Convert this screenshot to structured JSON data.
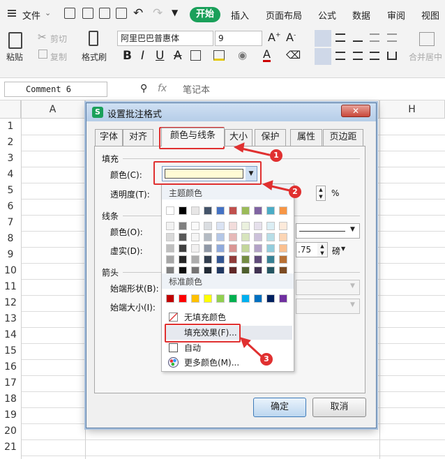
{
  "menubar": {
    "file_label": "文件",
    "tabs": [
      "开始",
      "插入",
      "页面布局",
      "公式",
      "数据",
      "审阅",
      "视图"
    ]
  },
  "ribbon": {
    "paste": "粘贴",
    "cut": "剪切",
    "copy": "复制",
    "format_painter": "格式刷",
    "font_name": "阿里巴巴普惠体",
    "font_size": "9",
    "merge_center": "合并居中"
  },
  "formula_bar": {
    "name_box": "Comment 6",
    "fx": "fx",
    "content": "笔记本"
  },
  "grid": {
    "columns": [
      "A",
      "G",
      "H"
    ],
    "rows": [
      "1",
      "2",
      "3",
      "4",
      "5",
      "6",
      "7",
      "8",
      "9",
      "10",
      "11",
      "12",
      "13",
      "14",
      "15",
      "16",
      "17",
      "18",
      "19",
      "20",
      "21"
    ]
  },
  "dialog": {
    "title": "设置批注格式",
    "tabs": [
      "字体",
      "对齐",
      "颜色与线条",
      "大小",
      "保护",
      "属性",
      "页边距"
    ],
    "fill_group": "填充",
    "fill_color_label": "颜色(C):",
    "transparency_label": "透明度(T):",
    "transparency_unit": "%",
    "line_group": "线条",
    "line_color_label": "颜色(O):",
    "dash_label": "虚实(D):",
    "weight_value": ".75",
    "weight_unit": "磅",
    "arrow_group": "箭头",
    "begin_style_label": "始端形状(B):",
    "begin_size_label": "始端大小(I):",
    "ok": "确定",
    "cancel": "取消"
  },
  "color_popup": {
    "theme_title": "主题颜色",
    "standard_title": "标准颜色",
    "theme_colors": [
      "#ffffff",
      "#000000",
      "#e7e6e6",
      "#44546a",
      "#4472c4",
      "#c0504d",
      "#9bbb59",
      "#8064a2",
      "#4bacc6",
      "#f79646"
    ],
    "standard_colors": [
      "#c00000",
      "#ff0000",
      "#ffc000",
      "#ffff00",
      "#92d050",
      "#00b050",
      "#00b0f0",
      "#0070c0",
      "#002060",
      "#7030a0"
    ],
    "no_fill": "无填充颜色",
    "fill_effects": "填充效果(F)...",
    "auto": "自动",
    "more_colors": "更多颜色(M)..."
  },
  "callouts": [
    "1",
    "2",
    "3"
  ],
  "selected_fill_color": "#fffbd5"
}
